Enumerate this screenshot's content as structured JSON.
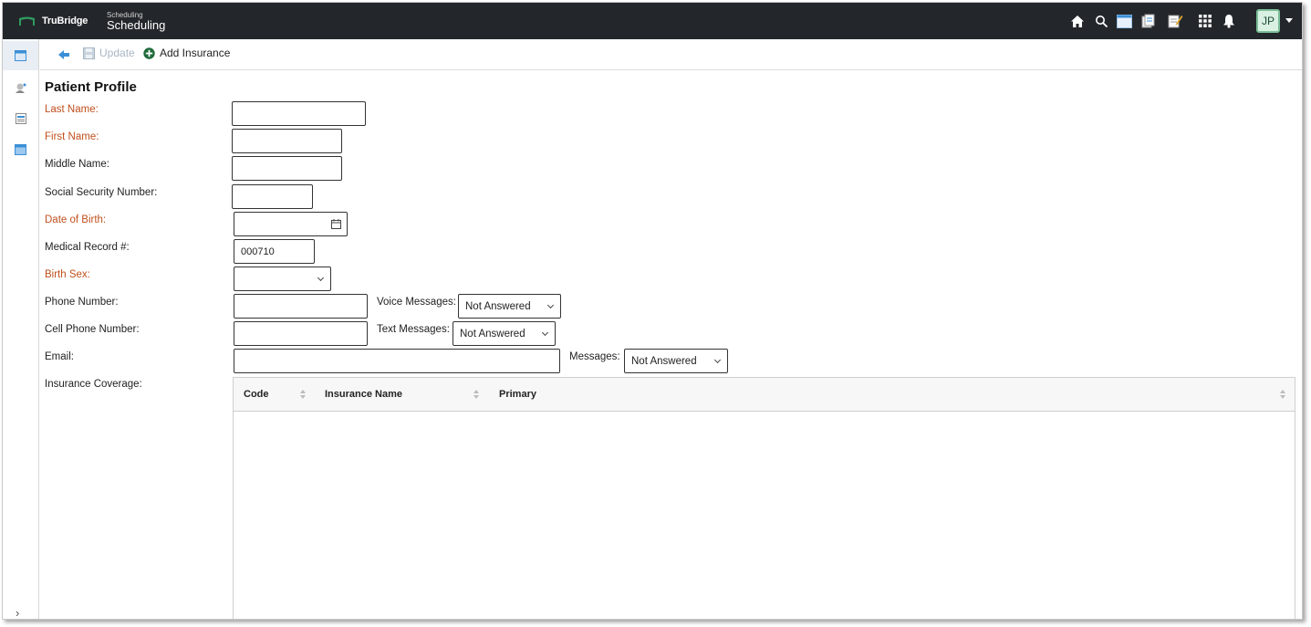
{
  "header": {
    "brand": "TruBridge",
    "app_subtitle": "Scheduling",
    "app_title": "Scheduling",
    "icons": [
      "home-icon",
      "search-icon",
      "window-icon",
      "documents-icon",
      "notes-icon",
      "apps-grid-icon",
      "bell-icon"
    ],
    "user_initials": "JP"
  },
  "sidebar": {
    "items": [
      "calendar-icon",
      "patient-icon",
      "schedule-list-icon",
      "calendar-alt-icon"
    ]
  },
  "toolbar": {
    "update_label": "Update",
    "add_insurance_label": "Add Insurance"
  },
  "form": {
    "title": "Patient Profile",
    "last_name_label": "Last Name:",
    "first_name_label": "First Name:",
    "middle_name_label": "Middle Name:",
    "ssn_label": "Social Security Number:",
    "dob_label": "Date of Birth:",
    "mrn_label": "Medical Record #:",
    "mrn_value": "000710",
    "birth_sex_label": "Birth Sex:",
    "phone_label": "Phone Number:",
    "voice_messages_label": "Voice Messages:",
    "voice_messages_value": "Not Answered",
    "cell_label": "Cell Phone Number:",
    "text_messages_label": "Text Messages:",
    "text_messages_value": "Not Answered",
    "email_label": "Email:",
    "messages_label": "Messages:",
    "messages_value": "Not Answered",
    "insurance_label": "Insurance Coverage:"
  },
  "insurance_grid": {
    "columns": [
      "Code",
      "Insurance Name",
      "Primary"
    ],
    "rows": []
  },
  "colors": {
    "topbar": "#23272b",
    "required_label": "#c0501d",
    "accent_blue": "#3b8fd6"
  }
}
